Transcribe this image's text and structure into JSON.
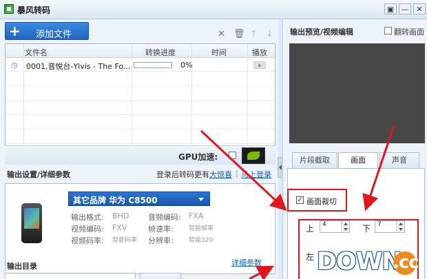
{
  "window": {
    "title": "暴风转码",
    "controls": [
      "▣",
      "—",
      "✕"
    ]
  },
  "toolbar": {
    "add_file_label": "添加文件",
    "add_icon": "plus-icon",
    "delete_icon": "close-icon",
    "clear_icon": "trash-icon",
    "up_icon": "arrow-up-icon",
    "down_icon": "arrow-down-icon"
  },
  "file_table": {
    "headers": [
      "文件名",
      "转换进度",
      "时间",
      "播放"
    ],
    "rows": [
      {
        "name": "0001.音悦台-Ylvis - The Fo...",
        "progress_text": "0%",
        "progress": 0,
        "time": ""
      }
    ]
  },
  "gpu": {
    "label": "GPU加速:",
    "checked": false
  },
  "output_settings": {
    "title": "输出设置/详细参数",
    "login_prompt": "登录后转码更有",
    "surprise_link": "大惊喜",
    "login_link": "马上登录",
    "device": "其它品牌  华为  C8500",
    "params": [
      {
        "label": "输出格式:",
        "value": "BHD"
      },
      {
        "label": "音频编码:",
        "value": "FXA"
      },
      {
        "label": "视频编码:",
        "value": "FXV"
      },
      {
        "label": "帧速率:",
        "value": "智能帧率"
      },
      {
        "label": "视频码率:",
        "value": "智能码率"
      },
      {
        "label": "分辨率:",
        "value": "智能320"
      }
    ],
    "detail_link": "详细参数"
  },
  "output_dir": {
    "title": "输出目录"
  },
  "preview": {
    "title": "输出预览/视频编辑",
    "flip_label": "翻转画面",
    "flip_checked": false
  },
  "tabs": [
    "片段截取",
    "画面",
    "声音"
  ],
  "active_tab": 1,
  "crop": {
    "label": "画面裁切",
    "checked": true,
    "top_label": "上",
    "top_value": "4",
    "bottom_label": "下",
    "bottom_value": "7",
    "left_label": "左"
  },
  "watermark": {
    "text": "DOWN",
    "suffix": ".cc"
  },
  "colors": {
    "accent": "#1f66c1",
    "annotation": "#e0161c"
  }
}
